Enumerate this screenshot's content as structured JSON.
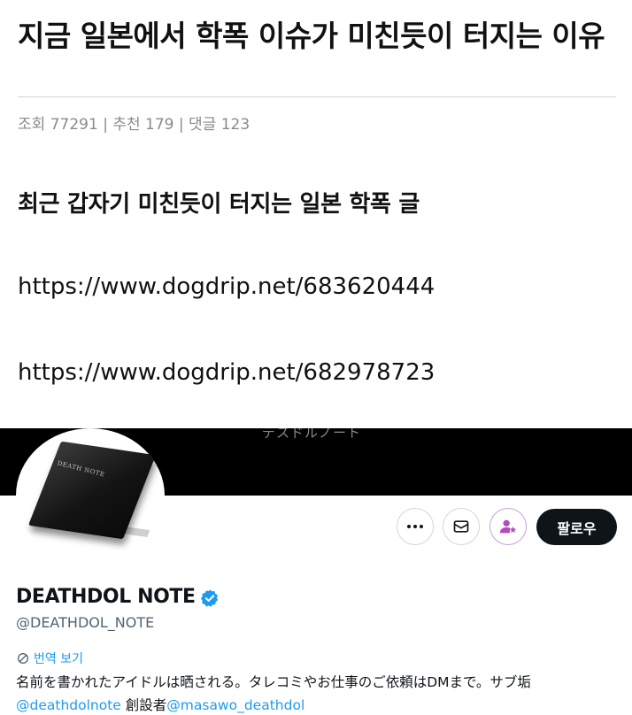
{
  "post": {
    "title": "지금 일본에서 학폭 이슈가 미친듯이 터지는 이유",
    "meta": {
      "views_label": "조회",
      "views": "77291",
      "likes_label": "추천",
      "likes": "179",
      "comments_label": "댓글",
      "comments": "123",
      "separator": "|"
    },
    "body": {
      "heading": "최근 갑자기 미친듯이 터지는 일본 학폭 글",
      "link1": "https://www.dogdrip.net/683620444",
      "link2": "https://www.dogdrip.net/682978723"
    }
  },
  "profile": {
    "banner_text": "デスドルノート",
    "avatar_label": "DEATH NOTE",
    "follow_label": "팔로우",
    "display_name": "DEATHDOL NOTE",
    "handle": "@DEATHDOL_NOTE",
    "translate_label": "번역 보기",
    "bio_line1": "名前を書かれたアイドルは晒される。タレコミやお仕事のご依頼はDMまで。サブ垢",
    "bio_mention1": "@deathdolnote",
    "bio_middle": " 創設者",
    "bio_mention2": "@masawo_deathdol",
    "colors": {
      "accent": "#1d9bf0",
      "verified": "#1d9bf0",
      "follow_bg": "#0f1419",
      "subscribe": "#b24bbd"
    }
  }
}
